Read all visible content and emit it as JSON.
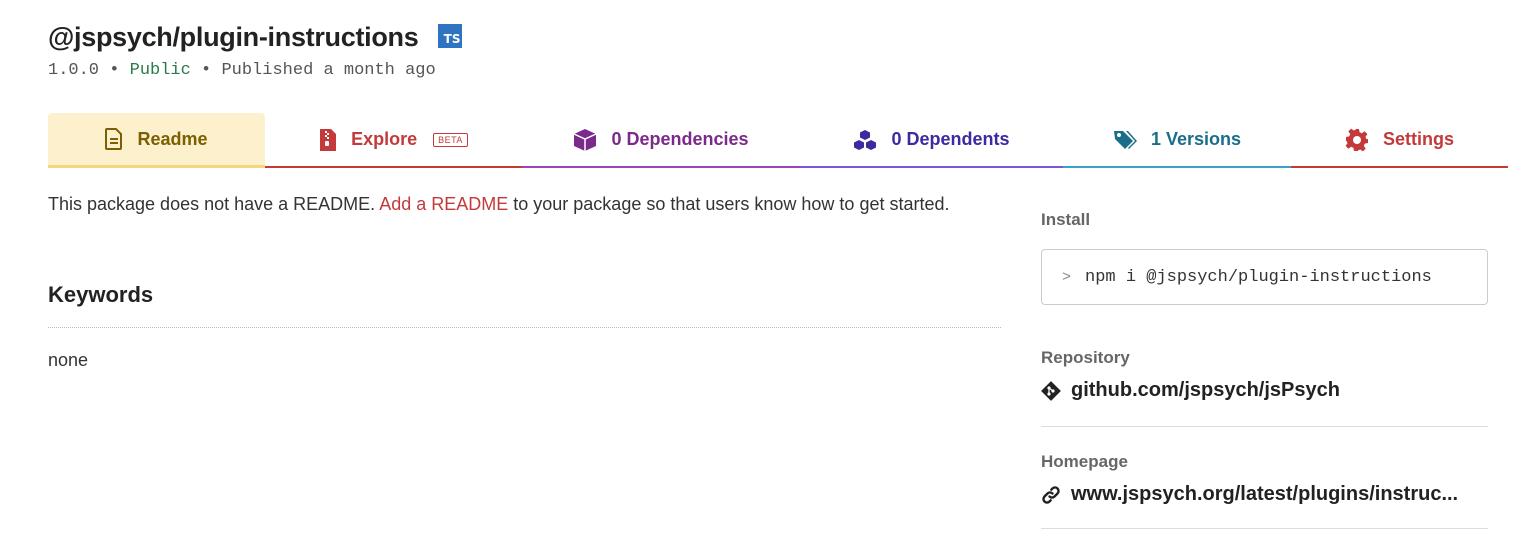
{
  "package": {
    "name": "@jspsych/plugin-instructions",
    "ts_badge": "TS",
    "version": "1.0.0",
    "sep1": " • ",
    "visibility": "Public",
    "sep2": " • ",
    "published": "Published a month ago"
  },
  "tabs": [
    {
      "label": "Readme",
      "icon": "file-icon"
    },
    {
      "label": "Explore",
      "icon": "zip-file-icon",
      "badge": "BETA"
    },
    {
      "label": "0 Dependencies",
      "icon": "box-icon"
    },
    {
      "label": "0 Dependents",
      "icon": "cubes-icon"
    },
    {
      "label": "1 Versions",
      "icon": "tags-icon"
    },
    {
      "label": "Settings",
      "icon": "gear-icon"
    }
  ],
  "readme": {
    "prefix": "This package does not have a README. ",
    "link": "Add a README",
    "suffix": " to your package so that users know how to get started."
  },
  "keywords": {
    "title": "Keywords",
    "value": "none"
  },
  "sidebar": {
    "install_label": "Install",
    "install_prompt": ">",
    "install_command": "npm i @jspsych/plugin-instructions",
    "repository_label": "Repository",
    "repository_link": "github.com/jspsych/jsPsych",
    "homepage_label": "Homepage",
    "homepage_link": "www.jspsych.org/latest/plugins/instruc..."
  },
  "colors": {
    "accent_red": "#c43a3a",
    "readme_tab_bg": "#fdf0cc",
    "public_green": "#2a7a4a"
  }
}
